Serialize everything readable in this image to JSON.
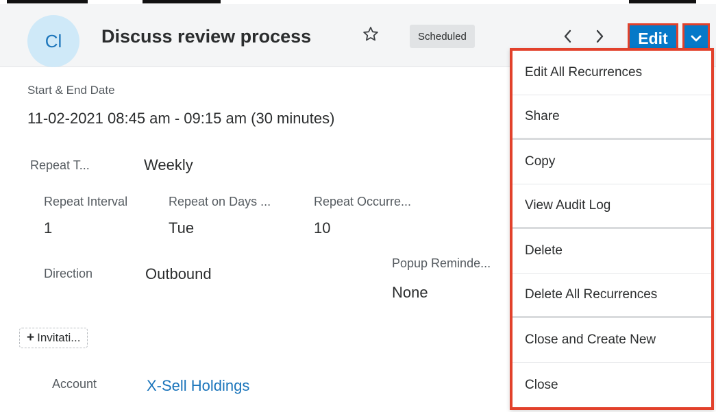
{
  "header": {
    "avatar_initials": "Cl",
    "title": "Discuss review process",
    "status": "Scheduled",
    "edit_label": "Edit"
  },
  "menu": {
    "items": [
      {
        "label": "Edit All Recurrences"
      },
      {
        "label": "Share"
      },
      {
        "label": "Copy"
      },
      {
        "label": "View Audit Log"
      },
      {
        "label": "Delete"
      },
      {
        "label": "Delete All Recurrences"
      },
      {
        "label": "Close and Create New"
      },
      {
        "label": "Close"
      }
    ]
  },
  "record": {
    "start_end_label": "Start & End Date",
    "start_end_value": "11-02-2021 08:45 am - 09:15 am (30 minutes)",
    "repeat_type_label": "Repeat T...",
    "repeat_type_value": "Weekly",
    "repeat_interval_label": "Repeat Interval",
    "repeat_interval_value": "1",
    "repeat_days_label": "Repeat on Days ...",
    "repeat_days_value": "Tue",
    "repeat_occurrences_label": "Repeat Occurre...",
    "repeat_occurrences_value": "10",
    "direction_label": "Direction",
    "direction_value": "Outbound",
    "popup_label": "Popup Reminde...",
    "popup_value": "None",
    "invitees_label": "Invitati...",
    "account_label": "Account",
    "account_value": "X-Sell Holdings"
  },
  "colors": {
    "accent_blue": "#0679c8",
    "highlight_red": "#e2412b",
    "link_blue": "#1b75bb"
  },
  "icons": [
    "star-icon",
    "chevron-left-icon",
    "chevron-right-icon",
    "chevron-down-icon",
    "plus-icon"
  ]
}
